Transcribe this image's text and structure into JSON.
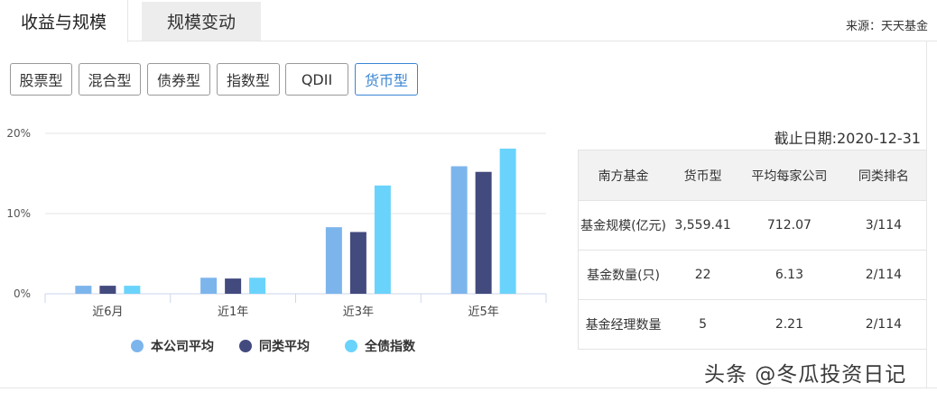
{
  "tabs": [
    {
      "label": "收益与规模",
      "active": true
    },
    {
      "label": "规模变动",
      "active": false
    }
  ],
  "source": "来源：天天基金",
  "filters": [
    {
      "label": "股票型",
      "active": false
    },
    {
      "label": "混合型",
      "active": false
    },
    {
      "label": "债券型",
      "active": false
    },
    {
      "label": "指数型",
      "active": false
    },
    {
      "label": "QDII",
      "active": false
    },
    {
      "label": "货币型",
      "active": true
    }
  ],
  "chart_data": {
    "type": "bar",
    "categories": [
      "近6月",
      "近1年",
      "近3年",
      "近5年"
    ],
    "series": [
      {
        "name": "本公司平均",
        "color": "#7cb5ec",
        "values": [
          1.0,
          2.0,
          8.3,
          15.9
        ]
      },
      {
        "name": "同类平均",
        "color": "#434a7e",
        "values": [
          1.0,
          1.9,
          7.7,
          15.2
        ]
      },
      {
        "name": "全债指数",
        "color": "#6ad3fb",
        "values": [
          1.0,
          2.0,
          13.5,
          18.1
        ]
      }
    ],
    "yticks": [
      "0%",
      "10%",
      "20%"
    ],
    "ylim": [
      0,
      20
    ],
    "grid": true,
    "legend": "bottom"
  },
  "cutoff_date": "截止日期:2020-12-31",
  "table": {
    "headers": [
      "南方基金",
      "货币型",
      "平均每家公司",
      "同类排名"
    ],
    "rows": [
      [
        "基金规模(亿元)",
        "3,559.41",
        "712.07",
        "3/114"
      ],
      [
        "基金数量(只)",
        "22",
        "6.13",
        "2/114"
      ],
      [
        "基金经理数量",
        "5",
        "2.21",
        "2/114"
      ]
    ]
  },
  "watermark": "头条 @冬瓜投资日记"
}
